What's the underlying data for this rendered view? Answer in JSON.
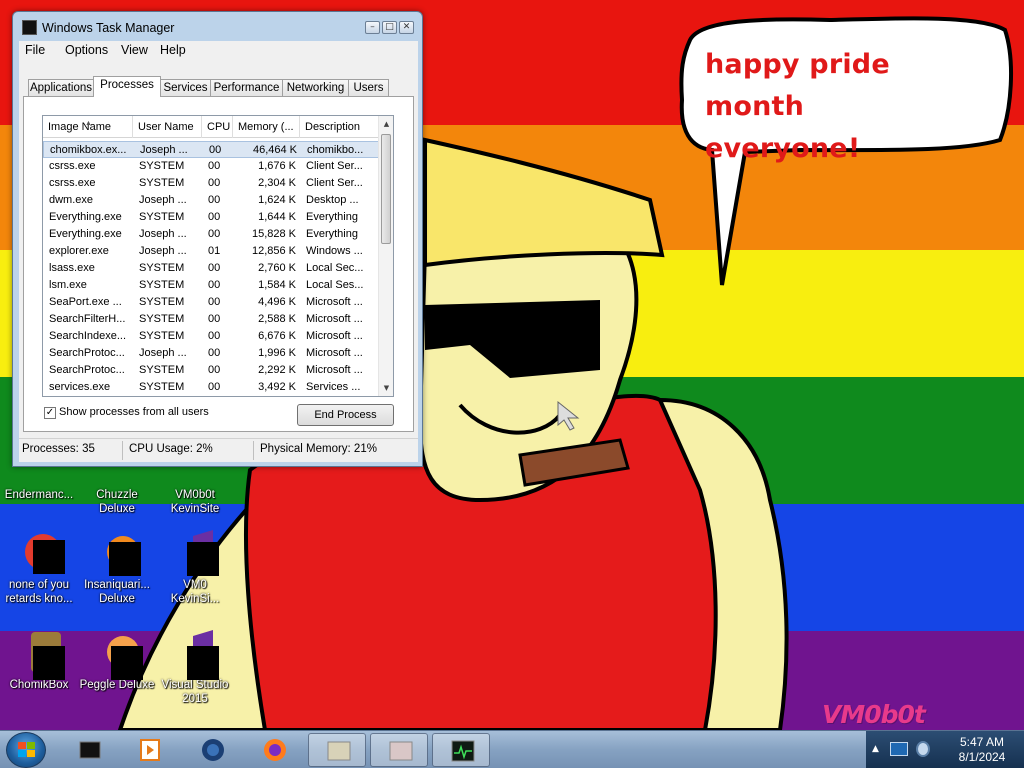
{
  "wallpaper": {
    "bubble_line1": "happy pride month",
    "bubble_line2": "everyone!",
    "watermark": "VM0b0t"
  },
  "colors": {
    "red": "#e8150f",
    "orange": "#f3860b",
    "yellow": "#f8ee0f",
    "green": "#0f8a1d",
    "blue": "#1545e6",
    "purple": "#70148f",
    "bubble_text": "#e01919",
    "selection": "#dbe6f3"
  },
  "desktop_icons": [
    {
      "label1": "Endermanc...",
      "label2": "",
      "icon": "app-icon"
    },
    {
      "label1": "Chuzzle",
      "label2": "Deluxe",
      "icon": "chuzzle-icon"
    },
    {
      "label1": "VM0b0t",
      "label2": "KevinSite",
      "icon": "shortcut-icon"
    },
    {
      "label1": "none of you",
      "label2": "retards kno...",
      "icon": "chrome-icon"
    },
    {
      "label1": "Insaniquari...",
      "label2": "Deluxe",
      "icon": "insaniquarium-icon"
    },
    {
      "label1": "VM0",
      "label2": "KevinSi...",
      "icon": "visual-studio-icon"
    },
    {
      "label1": "ChomikBox",
      "label2": "",
      "icon": "chomikbox-icon"
    },
    {
      "label1": "Peggle Deluxe",
      "label2": "",
      "icon": "peggle-icon"
    },
    {
      "label1": "Visual Studio",
      "label2": "2015",
      "icon": "visual-studio-icon"
    }
  ],
  "window": {
    "title": "Windows Task Manager",
    "menu": [
      "File",
      "Options",
      "View",
      "Help"
    ],
    "tabs": [
      "Applications",
      "Processes",
      "Services",
      "Performance",
      "Networking",
      "Users"
    ],
    "active_tab": "Processes",
    "columns": [
      "Image Name",
      "User Name",
      "CPU",
      "Memory (...",
      "Description"
    ],
    "processes": [
      {
        "name": "chomikbox.ex...",
        "user": "Joseph ...",
        "cpu": "00",
        "mem": "46,464 K",
        "desc": "chomikbo...",
        "selected": true
      },
      {
        "name": "csrss.exe",
        "user": "SYSTEM",
        "cpu": "00",
        "mem": "1,676 K",
        "desc": "Client Ser..."
      },
      {
        "name": "csrss.exe",
        "user": "SYSTEM",
        "cpu": "00",
        "mem": "2,304 K",
        "desc": "Client Ser..."
      },
      {
        "name": "dwm.exe",
        "user": "Joseph ...",
        "cpu": "00",
        "mem": "1,624 K",
        "desc": "Desktop ..."
      },
      {
        "name": "Everything.exe",
        "user": "SYSTEM",
        "cpu": "00",
        "mem": "1,644 K",
        "desc": "Everything"
      },
      {
        "name": "Everything.exe",
        "user": "Joseph ...",
        "cpu": "00",
        "mem": "15,828 K",
        "desc": "Everything"
      },
      {
        "name": "explorer.exe",
        "user": "Joseph ...",
        "cpu": "01",
        "mem": "12,856 K",
        "desc": "Windows ..."
      },
      {
        "name": "lsass.exe",
        "user": "SYSTEM",
        "cpu": "00",
        "mem": "2,760 K",
        "desc": "Local Sec..."
      },
      {
        "name": "lsm.exe",
        "user": "SYSTEM",
        "cpu": "00",
        "mem": "1,584 K",
        "desc": "Local Ses..."
      },
      {
        "name": "SeaPort.exe ...",
        "user": "SYSTEM",
        "cpu": "00",
        "mem": "4,496 K",
        "desc": "Microsoft ..."
      },
      {
        "name": "SearchFilterH...",
        "user": "SYSTEM",
        "cpu": "00",
        "mem": "2,588 K",
        "desc": "Microsoft ..."
      },
      {
        "name": "SearchIndexe...",
        "user": "SYSTEM",
        "cpu": "00",
        "mem": "6,676 K",
        "desc": "Microsoft ..."
      },
      {
        "name": "SearchProtoc...",
        "user": "Joseph ...",
        "cpu": "00",
        "mem": "1,996 K",
        "desc": "Microsoft ..."
      },
      {
        "name": "SearchProtoc...",
        "user": "SYSTEM",
        "cpu": "00",
        "mem": "2,292 K",
        "desc": "Microsoft ..."
      },
      {
        "name": "services.exe",
        "user": "SYSTEM",
        "cpu": "00",
        "mem": "3,492 K",
        "desc": "Services ..."
      }
    ],
    "show_all_label": "Show processes from all users",
    "show_all_checked": true,
    "end_process_label": "End Process",
    "status": {
      "processes": "Processes: 35",
      "cpu": "CPU Usage: 2%",
      "memory": "Physical Memory: 21%"
    }
  },
  "taskbar": {
    "pinned": [
      "terminal-icon",
      "media-player-icon",
      "globe-icon",
      "firefox-icon",
      "window-thumbnail-icon",
      "window-thumbnail-icon",
      "task-manager-icon"
    ],
    "active_index": 6,
    "clock_time": "5:47 AM",
    "clock_date": "8/1/2024"
  }
}
